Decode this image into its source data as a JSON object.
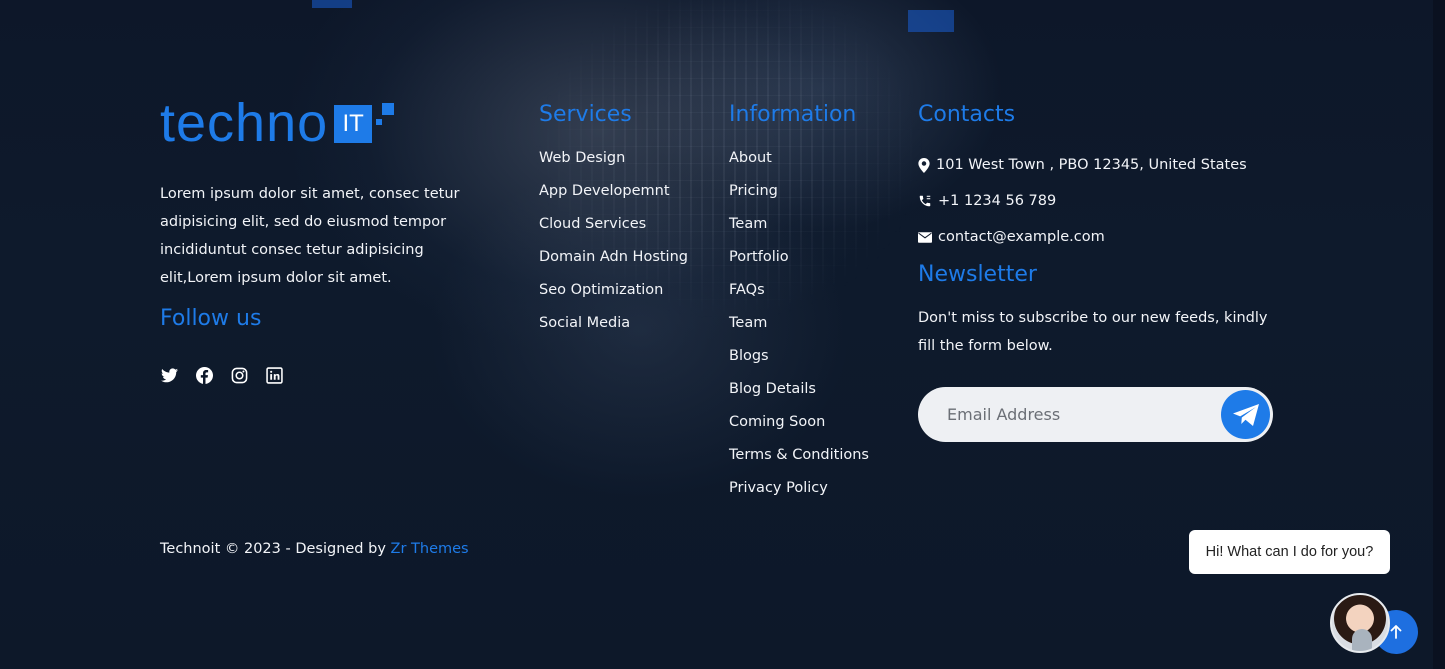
{
  "brand": {
    "logo_text": "techno",
    "logo_badge": "IT"
  },
  "about": {
    "text": "Lorem ipsum dolor sit amet, consec tetur adipisicing elit, sed do eiusmod tempor incididuntut consec tetur adipisicing elit,Lorem ipsum dolor sit amet."
  },
  "follow": {
    "heading": "Follow us",
    "icons": [
      "twitter-icon",
      "facebook-icon",
      "instagram-icon",
      "linkedin-icon"
    ]
  },
  "services": {
    "heading": "Services",
    "items": [
      "Web Design",
      "App Developemnt",
      "Cloud Services",
      "Domain Adn Hosting",
      "Seo Optimization",
      "Social Media"
    ]
  },
  "information": {
    "heading": "Information",
    "items": [
      "About",
      "Pricing",
      "Team",
      "Portfolio",
      "FAQs",
      "Team",
      "Blogs",
      "Blog Details",
      "Coming Soon",
      "Terms & Conditions",
      "Privacy Policy"
    ]
  },
  "contacts": {
    "heading": "Contacts",
    "address": "101 West Town , PBO 12345, United States",
    "phone": "+1 1234 56 789",
    "email": "contact@example.com"
  },
  "newsletter": {
    "heading": "Newsletter",
    "text": "Don't miss to subscribe to our new feeds, kindly fill the form below.",
    "email_placeholder": "Email Address"
  },
  "footer": {
    "copyright": "Technoit © 2023 - Designed by",
    "designer_link": "Zr Themes"
  },
  "chat": {
    "bubble_text": "Hi! What can I do for you?"
  },
  "colors": {
    "accent": "#1e7be8",
    "background": "#0d1729"
  }
}
